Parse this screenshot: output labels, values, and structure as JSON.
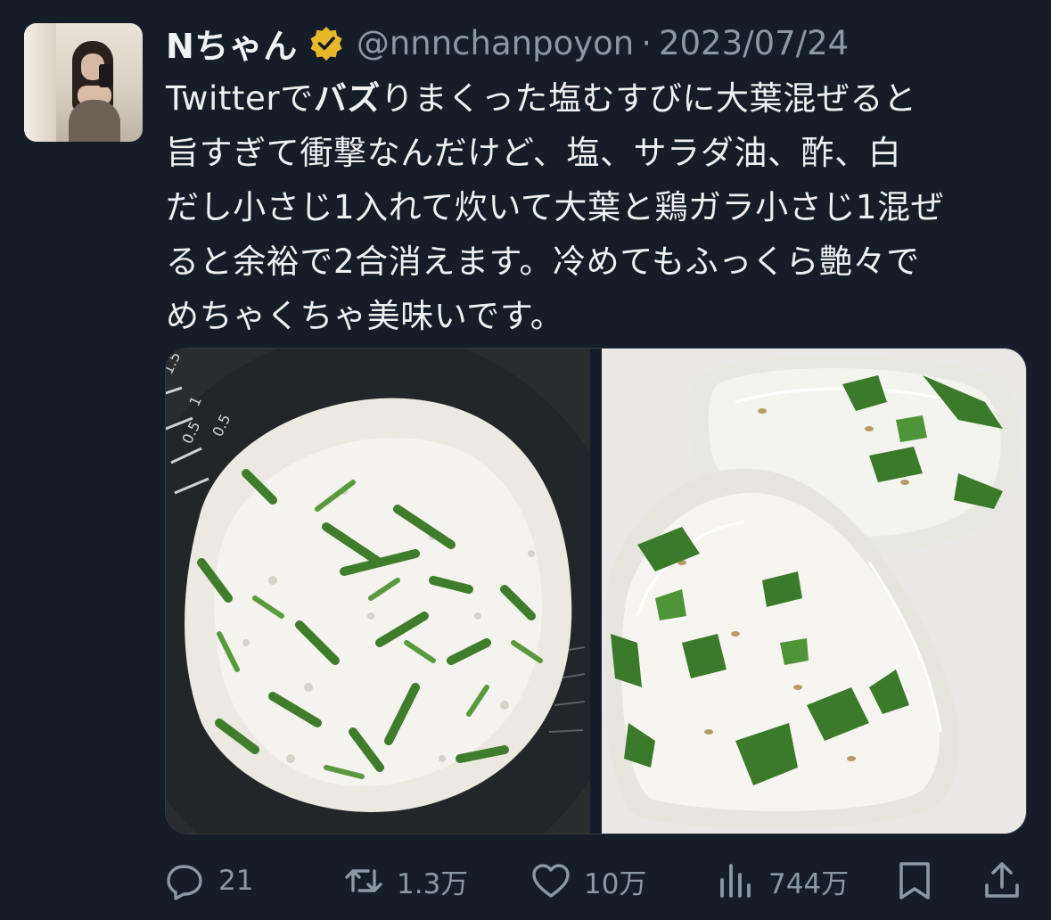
{
  "user": {
    "name": "Nちゃん",
    "handle": "@nnnchanpoyon",
    "separator": "·",
    "date": "2023/07/24",
    "verified": true
  },
  "tweet": {
    "lines": [
      {
        "pre": "Twitterで",
        "bold": "バズ",
        "post": "りまくった塩むすびに大葉混ぜると"
      },
      {
        "text": "旨すぎて衝撃なんだけど、塩、サラダ油、酢、白"
      },
      {
        "text": "だし小さじ1入れて炊いて大葉と鶏ガラ小さじ1混ぜ"
      },
      {
        "text": "ると余裕で2合消えます。冷めてもふっくら艶々で"
      },
      {
        "text": "めちゃくちゃ美味いです。"
      }
    ]
  },
  "media": {
    "photos": [
      {
        "subject": "rice-cooker-shiso-rice",
        "marks": [
          "1.5",
          "1",
          "0.5",
          "0.5"
        ]
      },
      {
        "subject": "wrapped-onigiri"
      }
    ]
  },
  "actions": {
    "reply": {
      "icon": "reply-icon",
      "count": "21"
    },
    "retweet": {
      "icon": "retweet-icon",
      "count": "1.3万"
    },
    "like": {
      "icon": "heart-icon",
      "count": "10万"
    },
    "views": {
      "icon": "views-chart-icon",
      "count": "744万"
    },
    "bookmark": {
      "icon": "bookmark-icon"
    },
    "share": {
      "icon": "share-icon"
    }
  },
  "colors": {
    "background": "#151d28",
    "text": "#e7e9ea",
    "muted": "#8b98a5",
    "verified_gold": "#e8b82a"
  }
}
